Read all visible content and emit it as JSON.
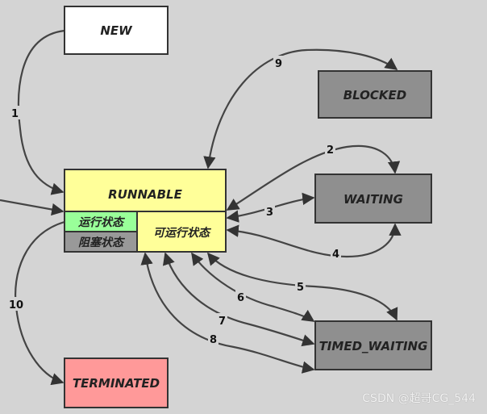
{
  "states": {
    "new": "NEW",
    "blocked": "BLOCKED",
    "waiting": "WAITING",
    "timed_waiting": "TIMED_WAITING",
    "terminated": "TERMINATED",
    "runnable": "RUNNABLE",
    "running": "运行状态",
    "blocking": "阻塞状态",
    "ready": "可运行状态"
  },
  "transitions": [
    "1",
    "2",
    "3",
    "4",
    "5",
    "6",
    "7",
    "8",
    "9",
    "10"
  ],
  "colors": {
    "new": "#ffffff",
    "blocked": "#8f8f8f",
    "runnable": "#ffff99",
    "running": "#99ff99",
    "terminated": "#ff9999"
  },
  "watermark": "CSDN @超哥CG_544"
}
